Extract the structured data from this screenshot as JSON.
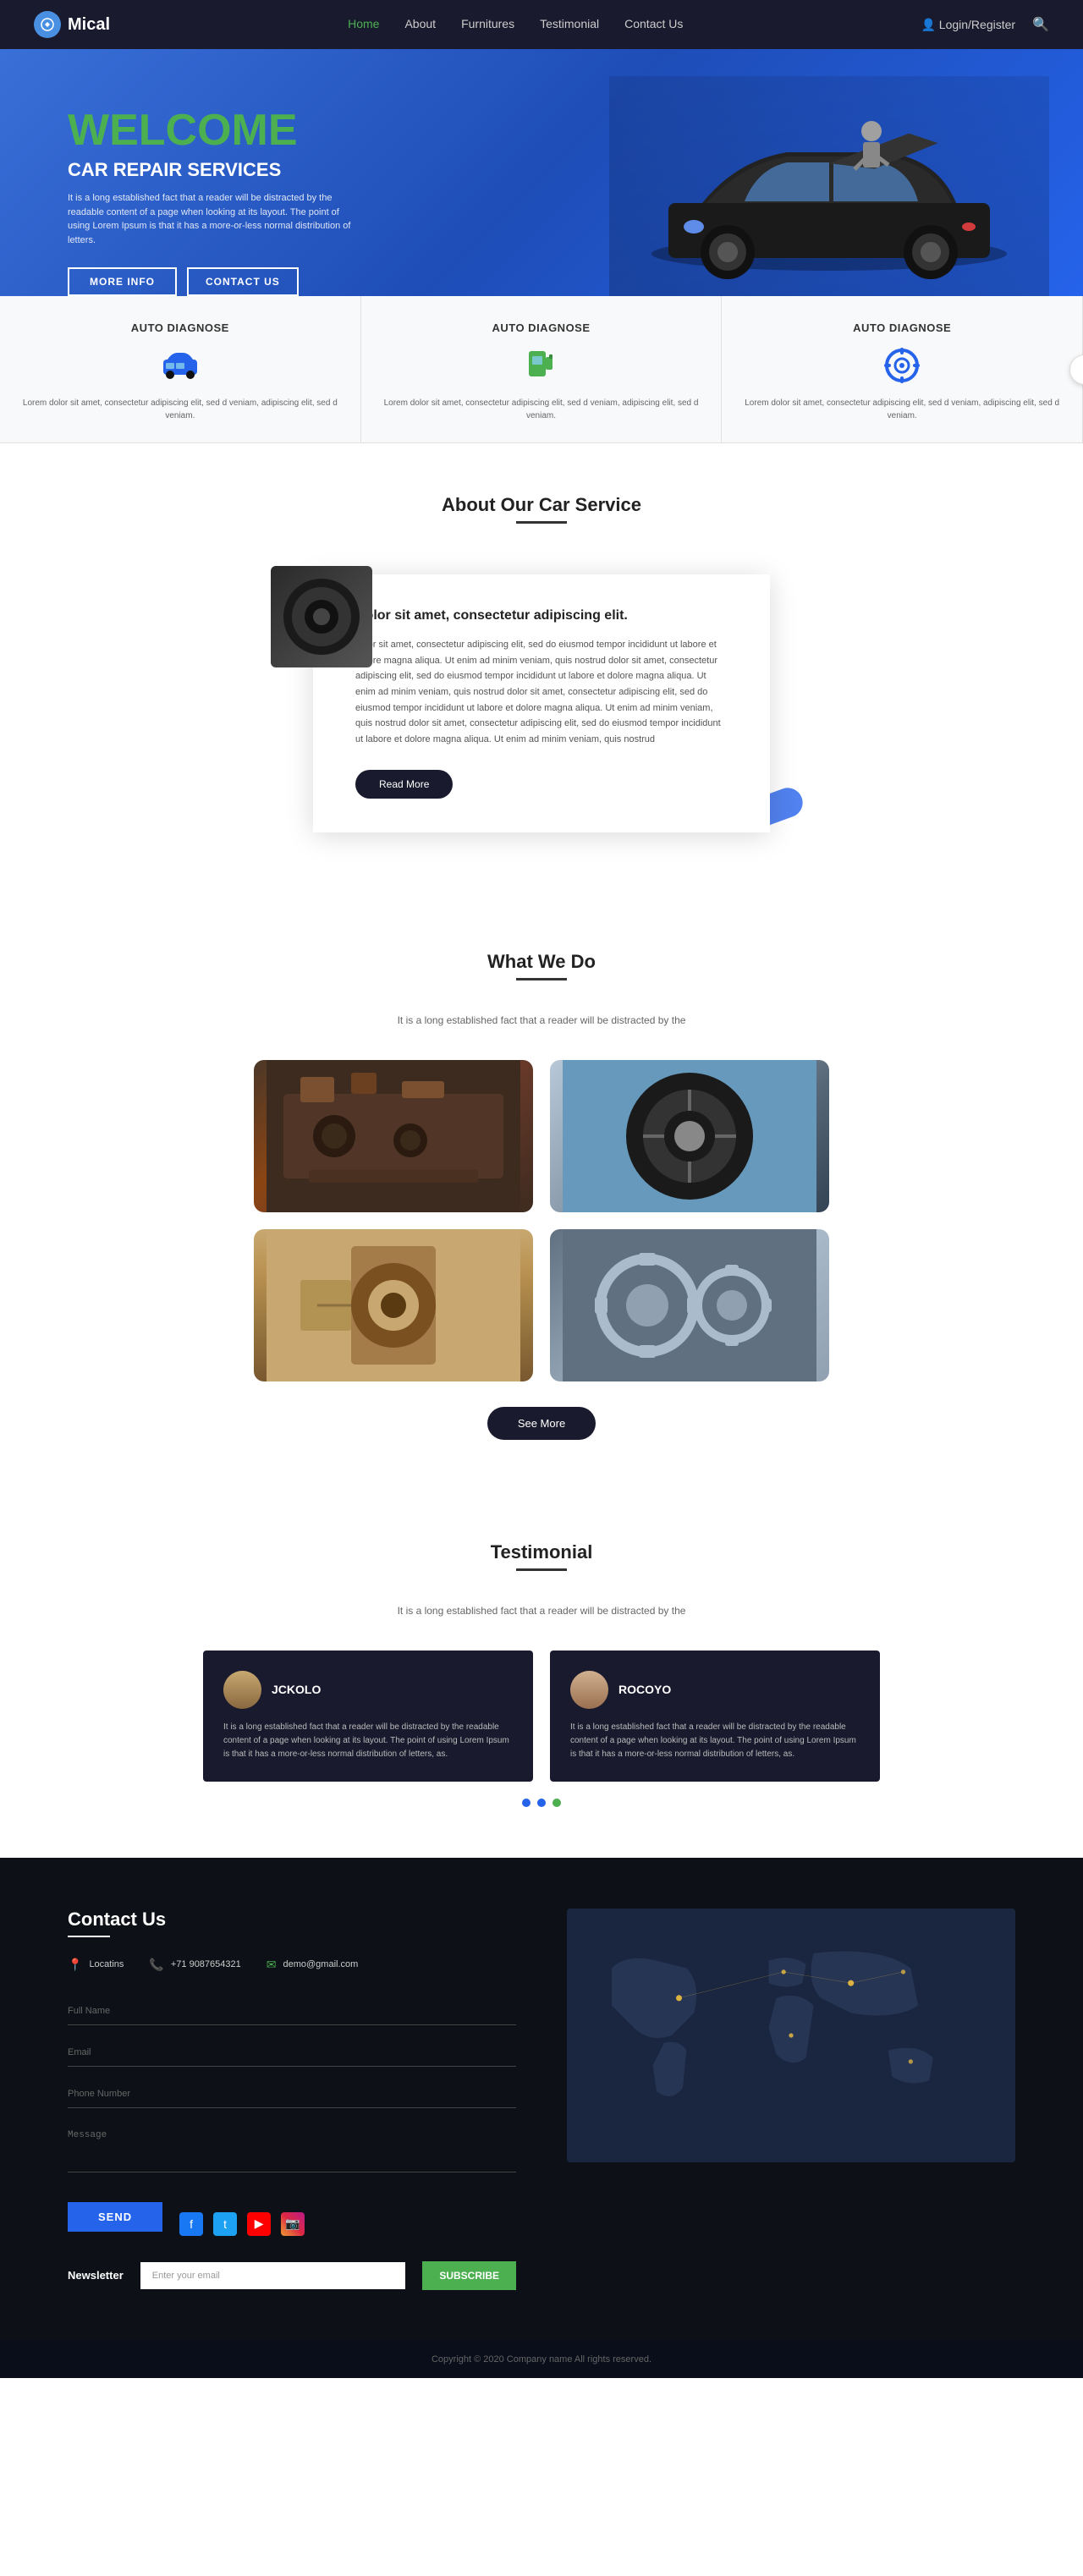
{
  "nav": {
    "logo": "Mical",
    "links": [
      {
        "label": "Home",
        "active": true
      },
      {
        "label": "About",
        "active": false
      },
      {
        "label": "Furnitures",
        "active": false
      },
      {
        "label": "Testimonial",
        "active": false
      },
      {
        "label": "Contact Us",
        "active": false
      }
    ],
    "login_register": "Login/Register"
  },
  "hero": {
    "welcome": "WELCOME",
    "subtitle": "CAR REPAIR SERVICES",
    "description": "It is a long established fact that a reader will be distracted by the readable content of a page when looking at its layout. The point of using Lorem Ipsum is that it has a more-or-less normal distribution of letters.",
    "btn_more_info": "MORE INFO",
    "btn_contact": "CONTACT US"
  },
  "services": {
    "title1": "AUTO DIAGNOSE",
    "title2": "AUTO DIAGNOSE",
    "title3": "AUTO DIAGNOSE",
    "desc": "Lorem dolor sit amet, consectetur adipiscing elit, sed d veniam, adipiscing elit, sed d veniam."
  },
  "about": {
    "section_title": "About Our Car Service",
    "card_title": "Dolor sit amet, consectetur adipiscing elit.",
    "card_body": "dolor sit amet, consectetur adipiscing elit, sed do eiusmod tempor incididunt ut labore et dolore magna aliqua. Ut enim ad minim veniam, quis nostrud dolor sit amet, consectetur adipiscing elit, sed do eiusmod tempor incididunt ut labore et dolore magna aliqua. Ut enim ad minim veniam, quis nostrud dolor sit amet, consectetur adipiscing elit, sed do eiusmod tempor incididunt ut labore et dolore magna aliqua. Ut enim ad minim veniam, quis nostrud dolor sit amet, consectetur adipiscing elit, sed do eiusmod tempor incididunt ut labore et dolore magna aliqua. Ut enim ad minim veniam, quis nostrud",
    "btn_read_more": "Read More"
  },
  "what_we_do": {
    "section_title": "What We Do",
    "description": "It is a long established fact that a reader will be distracted by the",
    "btn_see_more": "See More"
  },
  "testimonial": {
    "section_title": "Testimonial",
    "description": "It is a long established fact that a reader will be distracted by the",
    "testimonials": [
      {
        "name": "JCKOLO",
        "text": "It is a long established fact that a reader will be distracted by the readable content of a page when looking at its layout. The point of using Lorem Ipsum is that it has a more-or-less normal distribution of letters, as."
      },
      {
        "name": "ROCOYO",
        "text": "It is a long established fact that a reader will be distracted by the readable content of a page when looking at its layout. The point of using Lorem Ipsum is that it has a more-or-less normal distribution of letters, as."
      }
    ]
  },
  "contact": {
    "title": "Contact Us",
    "location": "Locatins",
    "phone": "+71 9087654321",
    "email": "demo@gmail.com",
    "fields": {
      "full_name": "Full Name",
      "email": "Email",
      "phone": "Phone Number",
      "message": "Message"
    },
    "btn_send": "SEND"
  },
  "newsletter": {
    "label": "Newsletter",
    "placeholder": "Enter your email",
    "btn_subscribe": "SUBSCRIBE"
  },
  "copyright": "Copyright © 2020 Company name All rights reserved."
}
